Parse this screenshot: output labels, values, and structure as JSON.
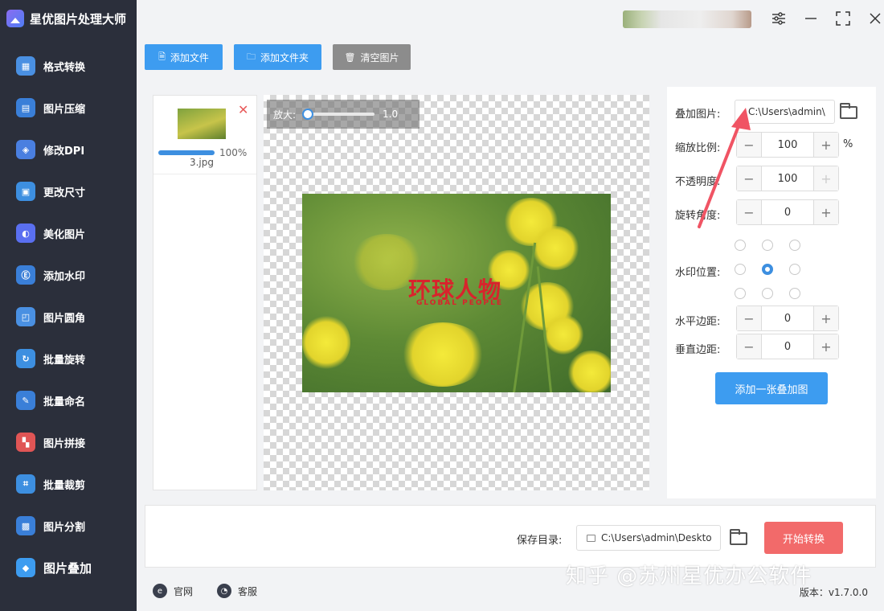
{
  "app": {
    "title": "星优图片处理大师"
  },
  "colors": {
    "sidebar_bg": "#2b2f3b",
    "primary": "#3d9cf0",
    "danger": "#f26a6a",
    "clear_btn": "#8c8c8c"
  },
  "nav": {
    "items": [
      {
        "label": "格式转换",
        "icon": "format-convert-icon",
        "color": "#4a90e2"
      },
      {
        "label": "图片压缩",
        "icon": "compress-icon",
        "color": "#3a7fd8"
      },
      {
        "label": "修改DPI",
        "icon": "dpi-icon",
        "color": "#4a7fe0"
      },
      {
        "label": "更改尺寸",
        "icon": "resize-icon",
        "color": "#3d8fe0"
      },
      {
        "label": "美化图片",
        "icon": "beautify-icon",
        "color": "#5a6ff0"
      },
      {
        "label": "添加水印",
        "icon": "watermark-icon",
        "color": "#3a7fd8"
      },
      {
        "label": "图片圆角",
        "icon": "round-corner-icon",
        "color": "#4a90e2"
      },
      {
        "label": "批量旋转",
        "icon": "rotate-icon",
        "color": "#3d8fe0"
      },
      {
        "label": "批量命名",
        "icon": "rename-icon",
        "color": "#3a7fd8"
      },
      {
        "label": "图片拼接",
        "icon": "stitch-icon",
        "color": "#e05555"
      },
      {
        "label": "批量裁剪",
        "icon": "crop-icon",
        "color": "#3d8fe0"
      },
      {
        "label": "图片分割",
        "icon": "split-icon",
        "color": "#3a7fd8"
      },
      {
        "label": "图片叠加",
        "icon": "overlay-icon",
        "color": "#3d9cf0"
      }
    ],
    "active_index": 12
  },
  "toolbar": {
    "add_file": "添加文件",
    "add_folder": "添加文件夹",
    "clear": "清空图片"
  },
  "file_list": [
    {
      "name": "3.jpg",
      "progress_text": "100%",
      "progress": 1.0
    }
  ],
  "preview": {
    "zoom_label": "放大:",
    "zoom_value": "1.0",
    "zoom_fraction": 0.0
  },
  "watermark": {
    "text": "环球人物",
    "sub": "GLOBAL PEOPLE"
  },
  "settings": {
    "overlay_label": "叠加图片:",
    "overlay_path": "C:\\Users\\admin\\",
    "scale_label": "缩放比例:",
    "scale_value": "100",
    "scale_unit": "%",
    "opacity_label": "不透明度:",
    "opacity_value": "100",
    "rotation_label": "旋转角度:",
    "rotation_value": "0",
    "position_label": "水印位置:",
    "position_selected": 4,
    "hmargin_label": "水平边距:",
    "hmargin_value": "0",
    "vmargin_label": "垂直边距:",
    "vmargin_value": "0",
    "add_button": "添加一张叠加图"
  },
  "bottom": {
    "save_label": "保存目录:",
    "save_path": "C:\\Users\\admin\\Deskto",
    "start_button": "开始转换"
  },
  "footer": {
    "website": "官网",
    "support": "客服",
    "version": "版本：v1.7.0.0"
  },
  "overlay_watermark": "知乎 @苏州星优办公软件"
}
